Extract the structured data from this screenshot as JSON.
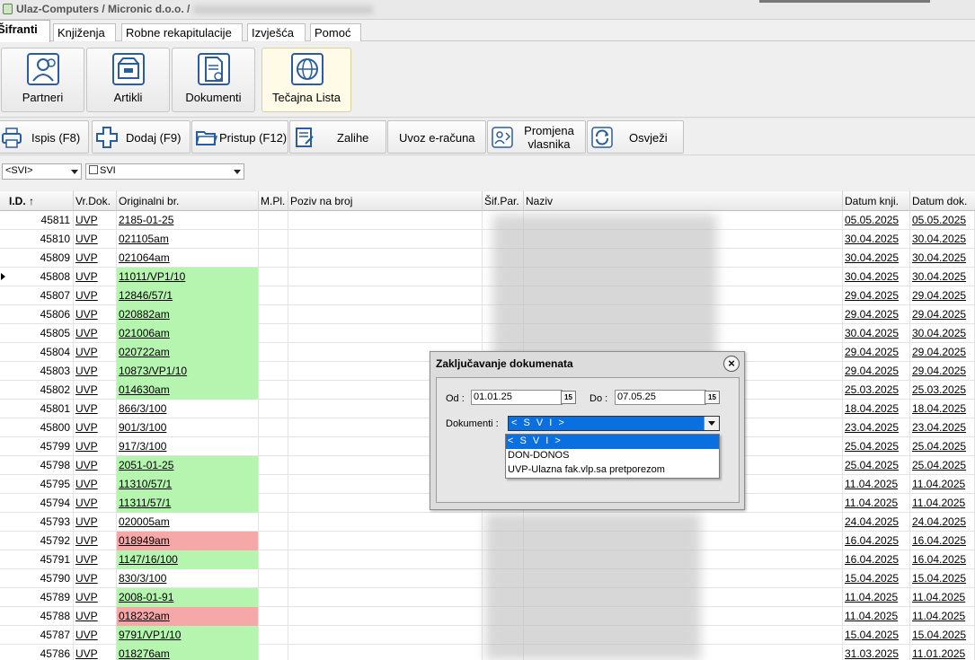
{
  "window": {
    "title": "Ulaz-Computers / Micronic d.o.o. /"
  },
  "menu": {
    "tabs": [
      "Šifranti",
      "Knjiženja",
      "Robne rekapitulacije",
      "Izvješća",
      "Pomoć"
    ]
  },
  "ribbon": {
    "buttons": [
      "Partneri",
      "Artikli",
      "Dokumenti",
      "Tečajna Lista"
    ]
  },
  "toolbar": {
    "ispis": "Ispis (F8)",
    "dodaj": "Dodaj (F9)",
    "pristup": "Pristup (F12)",
    "zalihe": "Zalihe",
    "uvoz": "Uvoz e-računa",
    "promjena_1": "Promjena",
    "promjena_2": "vlasnika",
    "osvjezi": "Osvježi"
  },
  "filters": {
    "first": "<SVI>",
    "second": "SVI"
  },
  "grid": {
    "columns": [
      "I.D. ↑",
      "Vr.Dok.",
      "Originalni br.",
      "M.Pl.",
      "Poziv na broj",
      "Šif.Par.",
      "Naziv",
      "Datum knji.",
      "Datum dok."
    ],
    "rows": [
      {
        "id": "45811",
        "vr": "UVP",
        "orig": "2185-01-25",
        "hl": "",
        "dk": "05.05.2025",
        "dd": "05.05.2025"
      },
      {
        "id": "45810",
        "vr": "UVP",
        "orig": "021105am",
        "hl": "",
        "dk": "30.04.2025",
        "dd": "30.04.2025"
      },
      {
        "id": "45809",
        "vr": "UVP",
        "orig": "021064am",
        "hl": "",
        "dk": "30.04.2025",
        "dd": "30.04.2025"
      },
      {
        "id": "45808",
        "vr": "UVP",
        "orig": "11011/VP1/10",
        "hl": "green",
        "dk": "30.04.2025",
        "dd": "30.04.2025"
      },
      {
        "id": "45807",
        "vr": "UVP",
        "orig": "12846/57/1",
        "hl": "green",
        "dk": "29.04.2025",
        "dd": "29.04.2025"
      },
      {
        "id": "45806",
        "vr": "UVP",
        "orig": "020882am",
        "hl": "green",
        "dk": "29.04.2025",
        "dd": "29.04.2025"
      },
      {
        "id": "45805",
        "vr": "UVP",
        "orig": "021006am",
        "hl": "green",
        "dk": "30.04.2025",
        "dd": "30.04.2025"
      },
      {
        "id": "45804",
        "vr": "UVP",
        "orig": "020722am",
        "hl": "green",
        "dk": "29.04.2025",
        "dd": "29.04.2025"
      },
      {
        "id": "45803",
        "vr": "UVP",
        "orig": "10873/VP1/10",
        "hl": "green",
        "dk": "29.04.2025",
        "dd": "29.04.2025"
      },
      {
        "id": "45802",
        "vr": "UVP",
        "orig": "014630am",
        "hl": "green",
        "dk": "25.03.2025",
        "dd": "25.03.2025"
      },
      {
        "id": "45801",
        "vr": "UVP",
        "orig": "866/3/100",
        "hl": "",
        "dk": "18.04.2025",
        "dd": "18.04.2025"
      },
      {
        "id": "45800",
        "vr": "UVP",
        "orig": "901/3/100",
        "hl": "",
        "dk": "23.04.2025",
        "dd": "23.04.2025"
      },
      {
        "id": "45799",
        "vr": "UVP",
        "orig": "917/3/100",
        "hl": "",
        "dk": "25.04.2025",
        "dd": "25.04.2025"
      },
      {
        "id": "45798",
        "vr": "UVP",
        "orig": "2051-01-25",
        "hl": "green",
        "dk": "25.04.2025",
        "dd": "25.04.2025"
      },
      {
        "id": "45795",
        "vr": "UVP",
        "orig": "11310/57/1",
        "hl": "green",
        "dk": "11.04.2025",
        "dd": "11.04.2025"
      },
      {
        "id": "45794",
        "vr": "UVP",
        "orig": "11311/57/1",
        "hl": "green",
        "dk": "11.04.2025",
        "dd": "11.04.2025"
      },
      {
        "id": "45793",
        "vr": "UVP",
        "orig": "020005am",
        "hl": "",
        "dk": "24.04.2025",
        "dd": "24.04.2025"
      },
      {
        "id": "45792",
        "vr": "UVP",
        "orig": "018949am",
        "hl": "red",
        "dk": "16.04.2025",
        "dd": "16.04.2025"
      },
      {
        "id": "45791",
        "vr": "UVP",
        "orig": "1147/16/100",
        "hl": "green",
        "dk": "16.04.2025",
        "dd": "16.04.2025"
      },
      {
        "id": "45790",
        "vr": "UVP",
        "orig": "830/3/100",
        "hl": "",
        "dk": "15.04.2025",
        "dd": "15.04.2025"
      },
      {
        "id": "45789",
        "vr": "UVP",
        "orig": "2008-01-91",
        "hl": "green",
        "dk": "11.04.2025",
        "dd": "11.04.2025"
      },
      {
        "id": "45788",
        "vr": "UVP",
        "orig": "018232am",
        "hl": "red",
        "dk": "11.04.2025",
        "dd": "11.04.2025"
      },
      {
        "id": "45787",
        "vr": "UVP",
        "orig": "9791/VP1/10",
        "hl": "green",
        "dk": "15.04.2025",
        "dd": "15.04.2025"
      },
      {
        "id": "45786",
        "vr": "UVP",
        "orig": "018276am",
        "hl": "green",
        "dk": "31.03.2025",
        "dd": "11.01.2025"
      }
    ]
  },
  "dialog": {
    "title": "Zaključavanje dokumenata",
    "od_label": "Od :",
    "od_value": "01.01.25",
    "do_label": "Do :",
    "do_value": "07.05.25",
    "cal_icon": "15",
    "dok_label": "Dokumenti :",
    "dok_value": "< S V I >",
    "options": [
      "< S V I >",
      "DON-DONOS",
      "UVP-Ulazna fak.vlp.sa pretporezom"
    ]
  },
  "colors": {
    "green": "#b6f5b0",
    "red": "#f6a8a8",
    "selection": "#0a6fe0"
  }
}
